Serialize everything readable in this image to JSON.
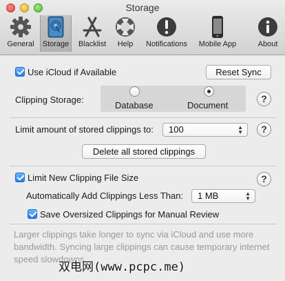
{
  "window": {
    "title": "Storage"
  },
  "toolbar": {
    "items": [
      {
        "label": "General",
        "icon": "gear-icon"
      },
      {
        "label": "Storage",
        "icon": "hard-drive-icon"
      },
      {
        "label": "Blacklist",
        "icon": "app-store-icon"
      },
      {
        "label": "Help",
        "icon": "lifebuoy-icon"
      },
      {
        "label": "Notifications",
        "icon": "exclamation-icon"
      },
      {
        "label": "Mobile App",
        "icon": "phone-icon"
      },
      {
        "label": "About",
        "icon": "info-icon"
      }
    ],
    "active": "Storage"
  },
  "icloud": {
    "label": "Use iCloud if Available",
    "checked": true,
    "reset_label": "Reset Sync"
  },
  "clipping_storage": {
    "label": "Clipping Storage:",
    "options": [
      "Database",
      "Document"
    ],
    "selected": "Document"
  },
  "limit": {
    "label": "Limit amount of stored clippings to:",
    "value": "100",
    "delete_label": "Delete all stored clippings"
  },
  "file_size": {
    "label": "Limit New Clipping File Size",
    "checked": true,
    "auto_add_label": "Automatically Add Clippings Less Than:",
    "auto_add_value": "1 MB",
    "save_oversized_label": "Save Oversized Clippings for Manual Review",
    "save_oversized_checked": true
  },
  "note": "Larger clippings take longer to sync via iCloud and use more bandwidth.  Syncing large clippings can cause temporary internet speed slowdowns.",
  "watermark": "(www.pcpc.me)",
  "help_glyph": "?",
  "colors": {
    "accent": "#1f7ef0",
    "background": "#ececec"
  }
}
